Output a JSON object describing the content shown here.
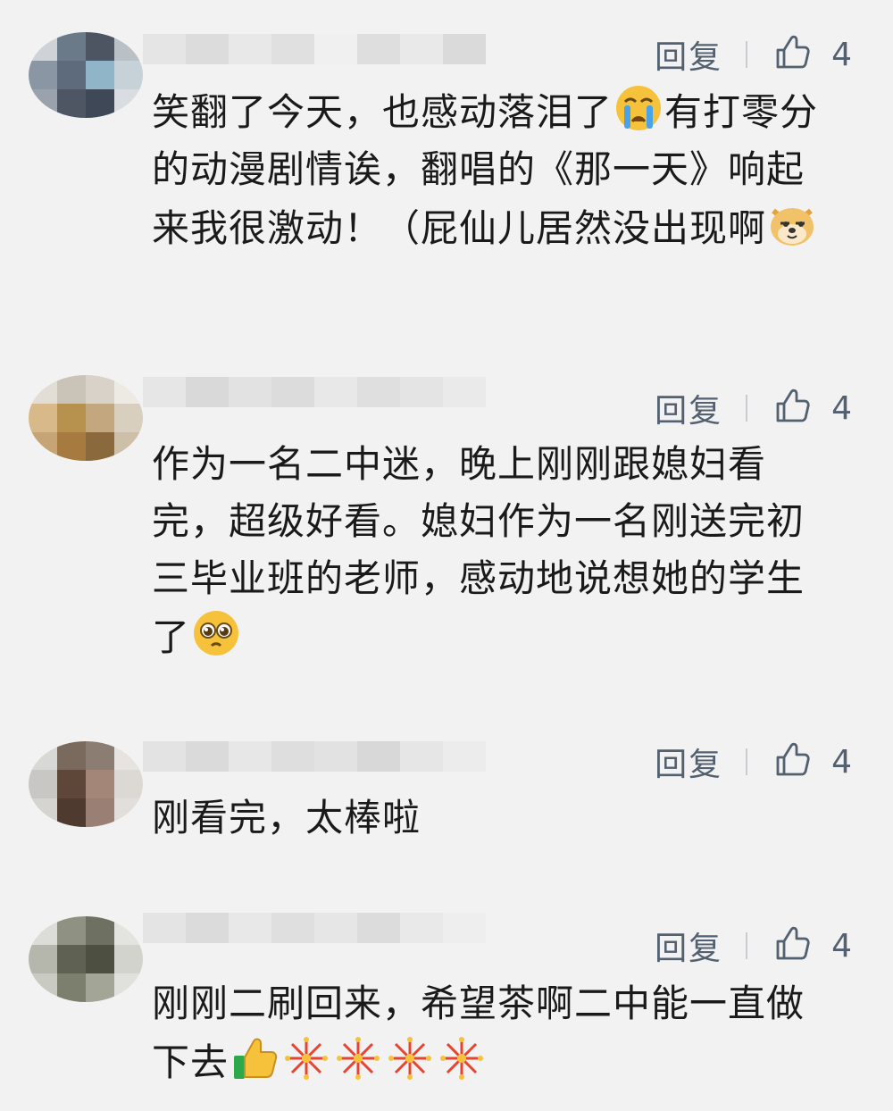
{
  "comments": [
    {
      "reply_label": "回复",
      "like_count": "4",
      "text": "笑翻了今天，也感动落泪了",
      "text2": "有打零分的动漫剧情诶，翻唱的《那一天》响起来我很激动！（屁仙儿居然没出现啊",
      "avatar_colors": [
        "#cfd3d8",
        "#6b7a89",
        "#4d5563",
        "#b9c0c6",
        "#8a96a3",
        "#5d6b7c",
        "#90b4c8",
        "#c7d1d8",
        "#9aa3ad",
        "#4e5664",
        "#3f4856",
        "#d9dde1"
      ],
      "name_colors": [
        "#e5e5e5",
        "#dcdcdc",
        "#e8e8e8",
        "#e0e0e0",
        "#f0f0f0",
        "#dedede",
        "#e9e9e9",
        "#dadada"
      ]
    },
    {
      "reply_label": "回复",
      "like_count": "4",
      "text": "作为一名二中迷，晚上刚刚跟媳妇看完，超级好看。媳妇作为一名刚送完初三毕业班的老师，感动地说想她的学生了",
      "avatar_colors": [
        "#e2ddd5",
        "#c9c3b8",
        "#d8d2c8",
        "#ede9e3",
        "#d7b98a",
        "#b7924e",
        "#c2a77f",
        "#d9cfbf",
        "#c6a476",
        "#a77a3f",
        "#8a6a3c",
        "#cdbfa8"
      ],
      "name_colors": [
        "#e6e6e6",
        "#d9d9d9",
        "#e2e2e2",
        "#dcdcdc",
        "#e8e8e8",
        "#dfdfdf",
        "#e4e4e4",
        "#eaeaea"
      ]
    },
    {
      "reply_label": "回复",
      "like_count": "4",
      "text": "刚看完，太棒啦",
      "avatar_colors": [
        "#d8d8d6",
        "#7a6a5e",
        "#8c7d72",
        "#e6e4e1",
        "#c9c7c3",
        "#5e4638",
        "#a48679",
        "#dcd9d5",
        "#d6d4d0",
        "#4f3a2f",
        "#9a7f74",
        "#e1dedb"
      ],
      "name_colors": [
        "#e3e3e3",
        "#dadada",
        "#e7e7e7",
        "#dedede",
        "#e2e2e2",
        "#d8d8d8",
        "#e6e6e6",
        "#ececec"
      ]
    },
    {
      "reply_label": "回复",
      "like_count": "4",
      "text": "刚刚二刷回来，希望茶啊二中能一直做下去",
      "avatar_colors": [
        "#dcdcd8",
        "#8f9183",
        "#6e7162",
        "#e3e3df",
        "#b5b6ac",
        "#5f6252",
        "#4d5040",
        "#d2d3cc",
        "#c9cac2",
        "#7c7f6e",
        "#a3a597",
        "#e0e0dc"
      ],
      "name_colors": [
        "#e4e4e4",
        "#dbdbdb",
        "#e8e8e8",
        "#dfdfdf",
        "#e6e6e6",
        "#dcdcdc",
        "#e9e9e9",
        "#eeeeee"
      ]
    }
  ]
}
